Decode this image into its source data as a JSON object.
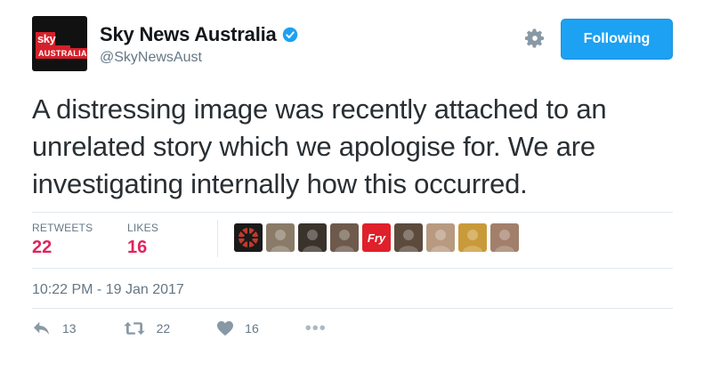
{
  "account": {
    "logo_text_top": "sky NEWS",
    "logo_text_bottom": "AUSTRALIA",
    "name": "Sky News Australia",
    "handle": "@SkyNewsAust"
  },
  "follow_button": {
    "label": "Following"
  },
  "tweet": {
    "text": "A distressing image was recently attached to an unrelated story which we apologise for. We are investigating internally how this occurred.",
    "timestamp": "10:22 PM - 19 Jan 2017"
  },
  "stats": {
    "retweets_label": "RETWEETS",
    "retweets": "22",
    "likes_label": "LIKES",
    "likes": "16"
  },
  "likers": [
    {
      "icon": "avatar-sunburst",
      "color": "#b0322a"
    },
    {
      "icon": "avatar-photo",
      "color": "#8a7b68"
    },
    {
      "icon": "avatar-photo",
      "color": "#3a332c"
    },
    {
      "icon": "avatar-photo",
      "color": "#6d5a4c"
    },
    {
      "icon": "avatar-fry-logo",
      "color": "#e0202a",
      "text": "Fry"
    },
    {
      "icon": "avatar-photo",
      "color": "#5c4a3d"
    },
    {
      "icon": "avatar-photo",
      "color": "#b89a80"
    },
    {
      "icon": "avatar-illustration",
      "color": "#c99a3a"
    },
    {
      "icon": "avatar-photo",
      "color": "#a27f6a"
    }
  ],
  "actions": {
    "reply_count": "13",
    "retweet_count": "22",
    "like_count": "16"
  },
  "colors": {
    "accent": "#1da1f2",
    "like": "#e0245e",
    "muted": "#657786"
  }
}
